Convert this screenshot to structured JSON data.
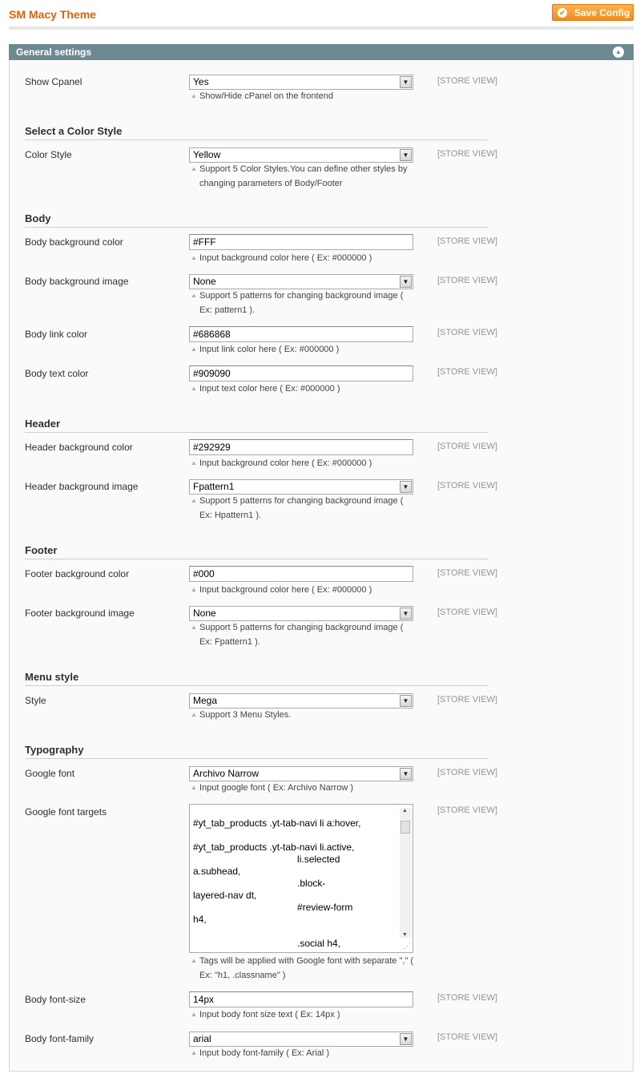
{
  "header": {
    "title": "SM Macy Theme",
    "save_label": "Save Config"
  },
  "panel": {
    "title": "General settings"
  },
  "scope_label": "[STORE VIEW]",
  "fields": {
    "show_cpanel": {
      "label": "Show Cpanel",
      "value": "Yes",
      "note": "Show/Hide cPanel on the frontend"
    },
    "color_style": {
      "label": "Color Style",
      "value": "Yellow",
      "note1": "Support 5 Color Styles.You can define other styles by",
      "note2": "changing parameters of Body/Footer"
    },
    "body_bg_color": {
      "label": "Body background color",
      "value": "#FFF",
      "note": "Input background color here ( Ex: #000000 )"
    },
    "body_bg_image": {
      "label": "Body background image",
      "value": "None",
      "note1": "Support 5 patterns for changing background image (",
      "note2": "Ex: pattern1 )."
    },
    "body_link_color": {
      "label": "Body link color",
      "value": "#686868",
      "note": "Input link color here ( Ex: #000000 )"
    },
    "body_text_color": {
      "label": "Body text color",
      "value": "#909090",
      "note": "Input text color here ( Ex: #000000 )"
    },
    "header_bg_color": {
      "label": "Header background color",
      "value": "#292929",
      "note": "Input background color here ( Ex: #000000 )"
    },
    "header_bg_image": {
      "label": "Header background image",
      "value": "Fpattern1",
      "note1": "Support 5 patterns for changing background image (",
      "note2": "Ex: Hpattern1 )."
    },
    "footer_bg_color": {
      "label": "Footer background color",
      "value": "#000",
      "note": "Input background color here ( Ex: #000000 )"
    },
    "footer_bg_image": {
      "label": "Footer background image",
      "value": "None",
      "note1": "Support 5 patterns for changing background image (",
      "note2": "Ex: Fpattern1 )."
    },
    "menu_style": {
      "label": "Style",
      "value": "Mega",
      "note": "Support 3 Menu Styles."
    },
    "google_font": {
      "label": "Google font",
      "value": "Archivo Narrow",
      "note": "Input google font ( Ex: Archivo Narrow )"
    },
    "google_font_targets": {
      "label": "Google font targets",
      "value": "#yt_tab_products .yt-tab-navi li a:hover,\n\n#yt_tab_products .yt-tab-navi li.active,\n                                       li.selected\na.subhead,\n                                       .block-\nlayered-nav dt,\n                                       #review-form\nh4,\n\n                                       .social h4,",
      "note1": "Tags will be applied with Google font with separate \",\" (",
      "note2": "Ex: \"h1, .classname\" )"
    },
    "body_font_size": {
      "label": "Body font-size",
      "value": "14px",
      "note": "Input body font size text ( Ex: 14px )"
    },
    "body_font_family": {
      "label": "Body font-family",
      "value": "arial",
      "note": "Input body font-family ( Ex: Arial )"
    }
  },
  "sections": {
    "color_style": "Select a Color Style",
    "body": "Body",
    "header": "Header",
    "footer": "Footer",
    "menu": "Menu style",
    "typography": "Typography"
  }
}
